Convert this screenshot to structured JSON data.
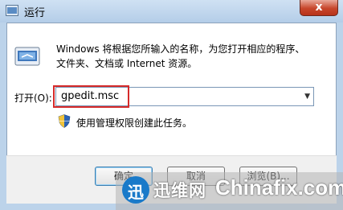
{
  "window": {
    "title": "运行",
    "close_glyph": "x"
  },
  "dialog": {
    "description": "Windows 将根据您所输入的名称，为您打开相应的程序、文件夹、文档或 Internet 资源。",
    "open_label": "打开(O):",
    "command_value": "gpedit.msc",
    "admin_notice": "使用管理权限创建此任务。",
    "ok_label": "确定",
    "cancel_label": "取消",
    "browse_label": "浏览(B)..."
  },
  "watermark": {
    "logo_text": "迅",
    "brand_cn": "迅维网",
    "brand_en": "Chinafix.com"
  },
  "icons": [
    "run-icon",
    "shield-icon",
    "dropdown-arrow-icon",
    "close-icon"
  ],
  "colors": {
    "highlight": "#d62a2a",
    "close_button": "#c7462b"
  }
}
